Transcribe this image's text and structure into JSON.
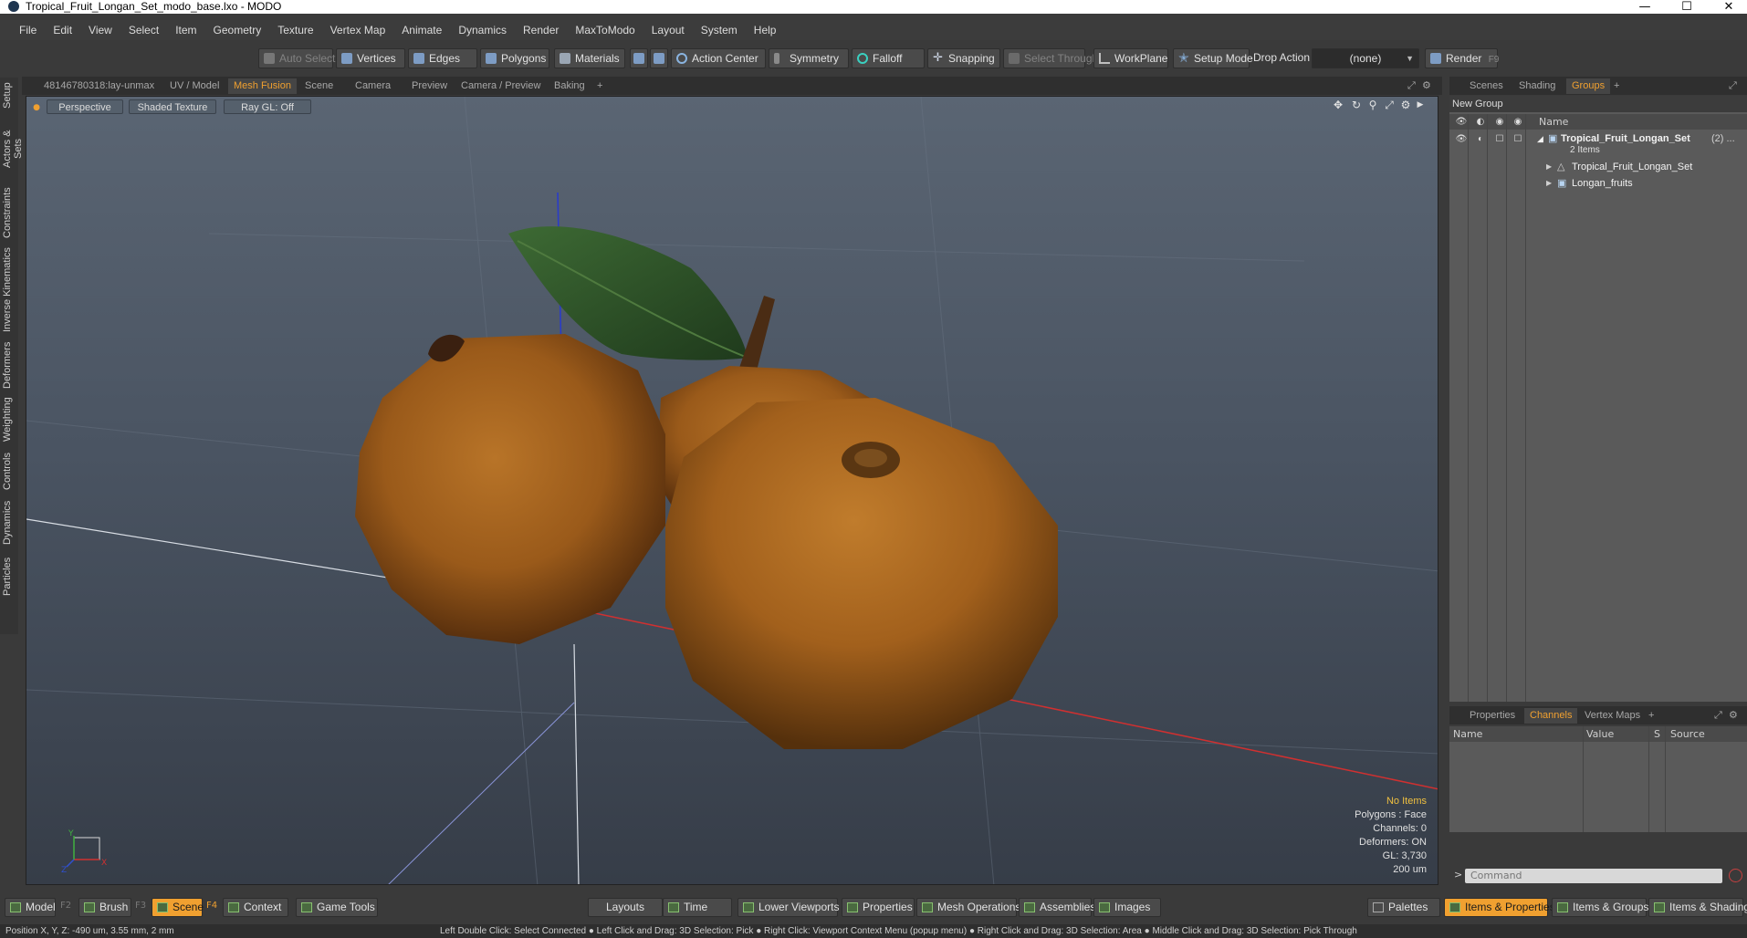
{
  "window": {
    "title": "Tropical_Fruit_Longan_Set_modo_base.lxo - MODO",
    "minimize_icon": "minimize-icon",
    "maximize_icon": "maximize-icon",
    "close_icon": "close-icon"
  },
  "menubar": {
    "items": [
      "File",
      "Edit",
      "View",
      "Select",
      "Item",
      "Geometry",
      "Texture",
      "Vertex Map",
      "Animate",
      "Dynamics",
      "Render",
      "MaxToModo",
      "Layout",
      "System",
      "Help"
    ]
  },
  "toolbar": {
    "auto_select": "Auto Select",
    "vertices": "Vertices",
    "edges": "Edges",
    "polygons": "Polygons",
    "materials": "Materials",
    "action_center": "Action Center",
    "symmetry": "Symmetry",
    "falloff": "Falloff",
    "snapping": "Snapping",
    "select_through": "Select Through",
    "workplane": "WorkPlane",
    "setup_mode": "Setup Mode",
    "drop_action_label": "Drop Action",
    "drop_action_value": "(none)",
    "render": "Render",
    "render_key": "F9"
  },
  "left_tabs": [
    "Setup",
    "Actors & Sets",
    "Constraints",
    "Inverse Kinematics",
    "Deformers",
    "Weighting",
    "Controls",
    "Dynamics",
    "Particles"
  ],
  "viewport_tabs": {
    "items": [
      "48146780318:lay-unmax",
      "UV / Model",
      "Mesh Fusion",
      "Scene",
      "Camera",
      "Preview",
      "Camera / Preview",
      "Baking"
    ],
    "active": "Mesh Fusion",
    "add": "+"
  },
  "viewport": {
    "view_mode": "Perspective",
    "shading": "Shaded Texture",
    "raygl": "Ray GL: Off",
    "info": {
      "selection": "No Items",
      "polygons": "Polygons : Face",
      "channels": "Channels: 0",
      "deformers": "Deformers: ON",
      "gl": "GL: 3,730",
      "scale": "200 um"
    },
    "axis_labels": {
      "x": "X",
      "y": "Y",
      "z": "Z"
    }
  },
  "right_top_tabs": {
    "items": [
      "Scenes",
      "Shading",
      "Groups"
    ],
    "active": "Groups",
    "add": "+"
  },
  "groups": {
    "new_group": "New Group",
    "name_header": "Name",
    "root": {
      "name": "Tropical_Fruit_Longan_Set",
      "count": "(2) ...",
      "sub": "2 Items"
    },
    "children": [
      "Tropical_Fruit_Longan_Set",
      "Longan_fruits"
    ]
  },
  "right_bottom_tabs": {
    "items": [
      "Properties",
      "Channels",
      "Vertex Maps"
    ],
    "active": "Channels",
    "add": "+"
  },
  "channels": {
    "headers": [
      "Name",
      "Value",
      "S",
      "Source"
    ]
  },
  "command": {
    "placeholder": "Command",
    "prompt": ">"
  },
  "bottombar": {
    "model": "Model",
    "model_key": "F2",
    "brush": "Brush",
    "brush_key": "F3",
    "scene": "Scene",
    "scene_key": "F4",
    "context": "Context",
    "game_tools": "Game Tools",
    "layouts": "Layouts",
    "time": "Time",
    "lower_viewports": "Lower Viewports",
    "properties": "Properties",
    "mesh_operations": "Mesh Operations",
    "assemblies": "Assemblies",
    "images": "Images",
    "palettes": "Palettes",
    "items_properties": "Items & Properties",
    "items_groups": "Items & Groups",
    "items_shading": "Items & Shading"
  },
  "statusbar": {
    "position": "Position X, Y, Z:   -490 um, 3.55 mm, 2 mm",
    "hint": "Left Double Click: Select Connected ● Left Click and Drag: 3D Selection: Pick ● Right Click: Viewport Context Menu (popup menu) ● Right Click and Drag: 3D Selection: Area ● Middle Click and Drag: 3D Selection: Pick Through"
  },
  "colors": {
    "accent": "#f0a030",
    "fruit": "#a4621c",
    "leaf": "#2f5a2a",
    "x_axis": "#d03030",
    "y_axis": "#2a3cc8"
  }
}
